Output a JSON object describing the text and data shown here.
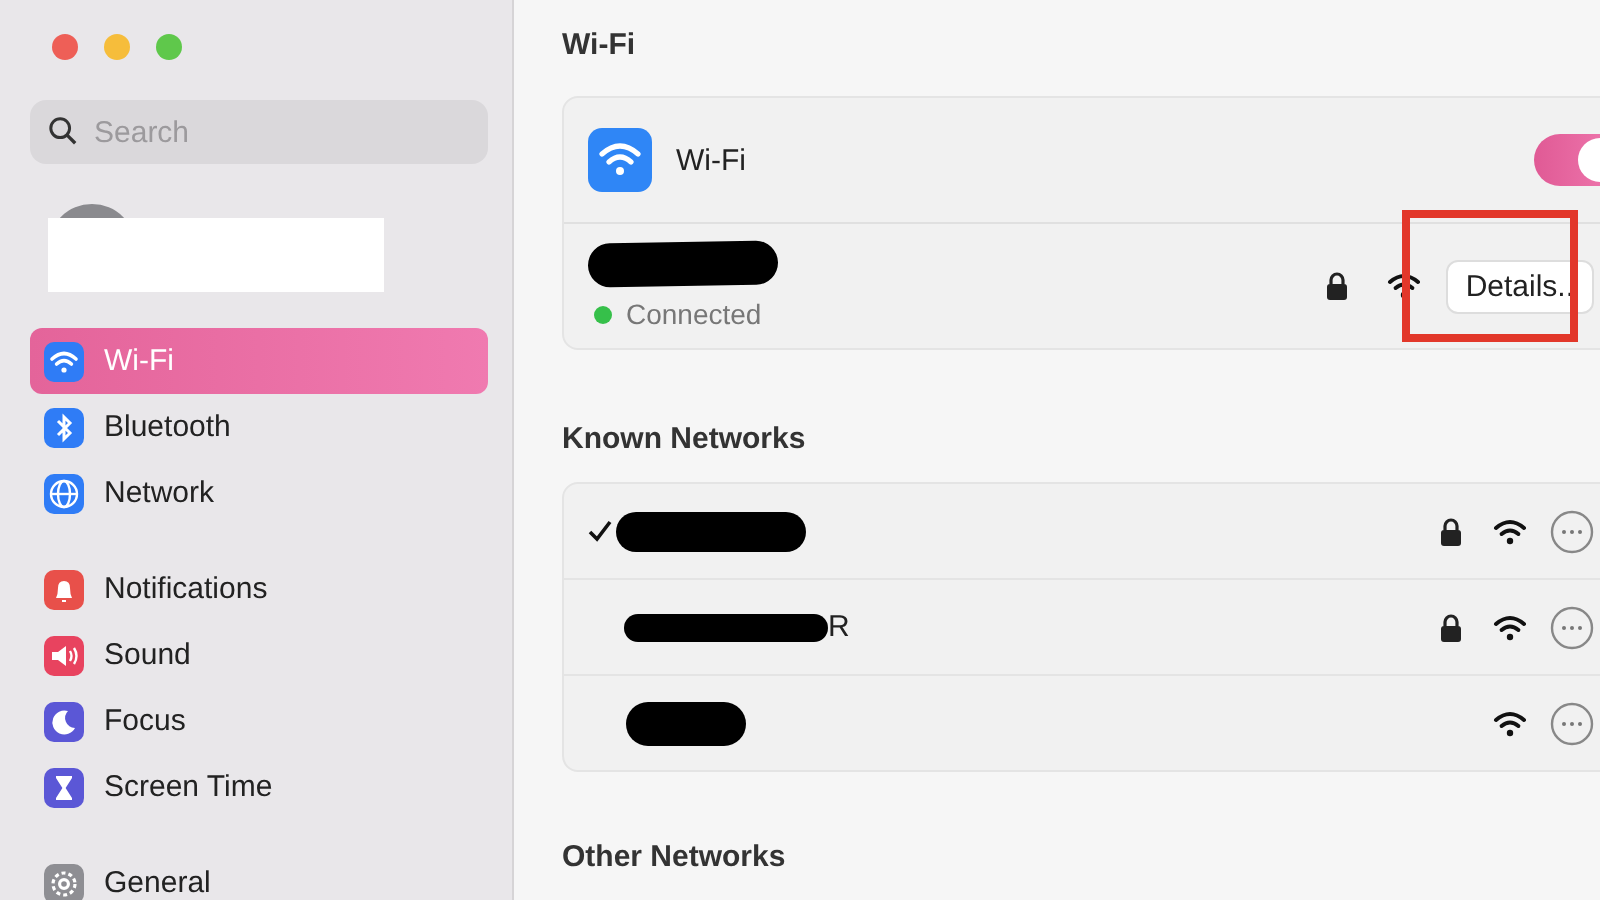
{
  "sidebar": {
    "search": {
      "placeholder": "Search"
    },
    "groups": [
      [
        {
          "label": "Wi-Fi",
          "kind": "wifi",
          "color": "#2f7cf6",
          "selected": true
        },
        {
          "label": "Bluetooth",
          "kind": "bluetooth",
          "color": "#2f7cf6",
          "selected": false
        },
        {
          "label": "Network",
          "kind": "globe",
          "color": "#2f7cf6",
          "selected": false
        }
      ],
      [
        {
          "label": "Notifications",
          "kind": "bell",
          "color": "#e8504a",
          "selected": false
        },
        {
          "label": "Sound",
          "kind": "speaker",
          "color": "#e8435f",
          "selected": false
        },
        {
          "label": "Focus",
          "kind": "moon",
          "color": "#5b57d6",
          "selected": false
        },
        {
          "label": "Screen Time",
          "kind": "hourglass",
          "color": "#5b57d6",
          "selected": false
        }
      ],
      [
        {
          "label": "General",
          "kind": "gear",
          "color": "#8e8e93",
          "selected": false
        }
      ]
    ]
  },
  "main": {
    "title": "Wi-Fi",
    "wifi_card": {
      "label": "Wi-Fi",
      "on": true
    },
    "current": {
      "status": "Connected",
      "secured": true,
      "button": "Details..",
      "highlighted": true
    },
    "known_title": "Known Networks",
    "known": [
      {
        "connected": true,
        "secured": true
      },
      {
        "connected": false,
        "secured": true,
        "name_tail": "R"
      },
      {
        "connected": false,
        "secured": false
      }
    ],
    "other_title": "Other Networks"
  }
}
